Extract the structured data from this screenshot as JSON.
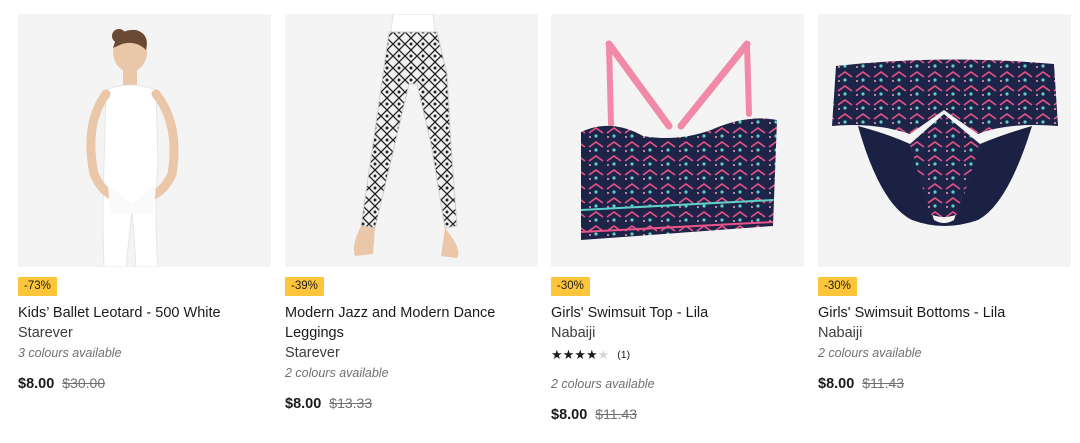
{
  "colors": {
    "badge": "#fcc53a",
    "image_bg": "#f5f4f5",
    "text": "#1b1b1b"
  },
  "products": [
    {
      "discount": "-73%",
      "name": "Kids’ Ballet Leotard - 500 White",
      "brand": "Starever",
      "colours": "3 colours available",
      "price": "$8.00",
      "old_price": "$30.00"
    },
    {
      "discount": "-39%",
      "name": "Modern Jazz and Modern Dance Leggings",
      "brand": "Starever",
      "colours": "2 colours available",
      "price": "$8.00",
      "old_price": "$13.33"
    },
    {
      "discount": "-30%",
      "name": "Girls' Swimsuit Top - Lila",
      "brand": "Nabaiji",
      "rating": 4,
      "rating_max": 5,
      "review_count": "(1)",
      "colours": "2 colours available",
      "price": "$8.00",
      "old_price": "$11.43"
    },
    {
      "discount": "-30%",
      "name": "Girls' Swimsuit Bottoms - Lila",
      "brand": "Nabaiji",
      "colours": "2 colours available",
      "price": "$8.00",
      "old_price": "$11.43"
    }
  ]
}
